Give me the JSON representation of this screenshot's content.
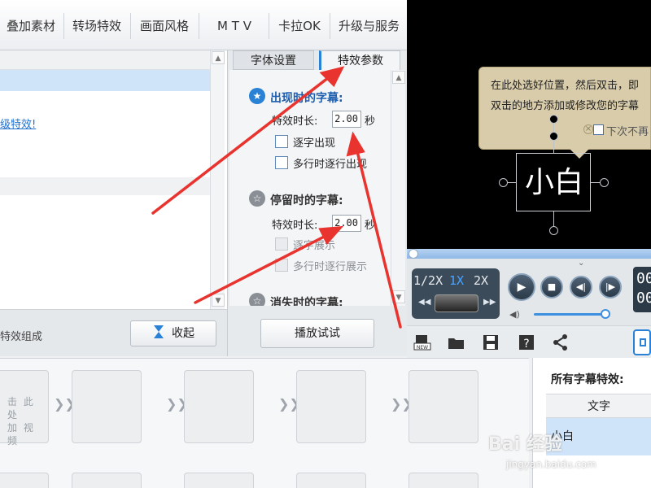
{
  "top_tabs": [
    "叠加素材",
    "转场特效",
    "画面风格",
    "M T V",
    "卡拉OK",
    "升级与服务"
  ],
  "left_list": {
    "link_text": "级特效!",
    "composed_label": "特效组成",
    "collapse_label": "收起"
  },
  "settings": {
    "tabs": [
      "字体设置",
      "特效参数"
    ],
    "appear": {
      "title": "出现时的字幕:",
      "duration_label": "特效时长:",
      "duration_value": "2.00",
      "unit": "秒",
      "opt1": "逐字出现",
      "opt2": "多行时逐行出现"
    },
    "stay": {
      "title": "停留时的字幕:",
      "duration_label": "特效时长:",
      "duration_value": "2.00",
      "unit": "秒",
      "opt1": "逐字展示",
      "opt2": "多行时逐行展示"
    },
    "disappear": {
      "title": "消失时的字幕:"
    },
    "play_button": "播放试试"
  },
  "preview": {
    "tooltip_line1": "在此处选好位置，然后双击，即",
    "tooltip_line2": "双击的地方添加或修改您的字幕",
    "tooltip_checkbox": "下次不再",
    "title_text": "小白"
  },
  "player": {
    "speeds": [
      "1/2X",
      "1X",
      "2X"
    ],
    "time_top": "00",
    "time_bottom": "00"
  },
  "thumbnails": {
    "placeholder_line1": "击 此 处",
    "placeholder_line2": "加 视 频"
  },
  "right_list": {
    "title": "所有字幕特效:",
    "header": "文字",
    "row": "小白"
  },
  "watermark": {
    "main": "Bai 经验",
    "sub": "jingyan.baidu.com"
  },
  "colors": {
    "accent": "#1d5fae",
    "selection": "#cfe3f9",
    "arrow": "#e8332e",
    "preview_bg": "#000000",
    "tooltip_bg": "#d9ccaa"
  }
}
